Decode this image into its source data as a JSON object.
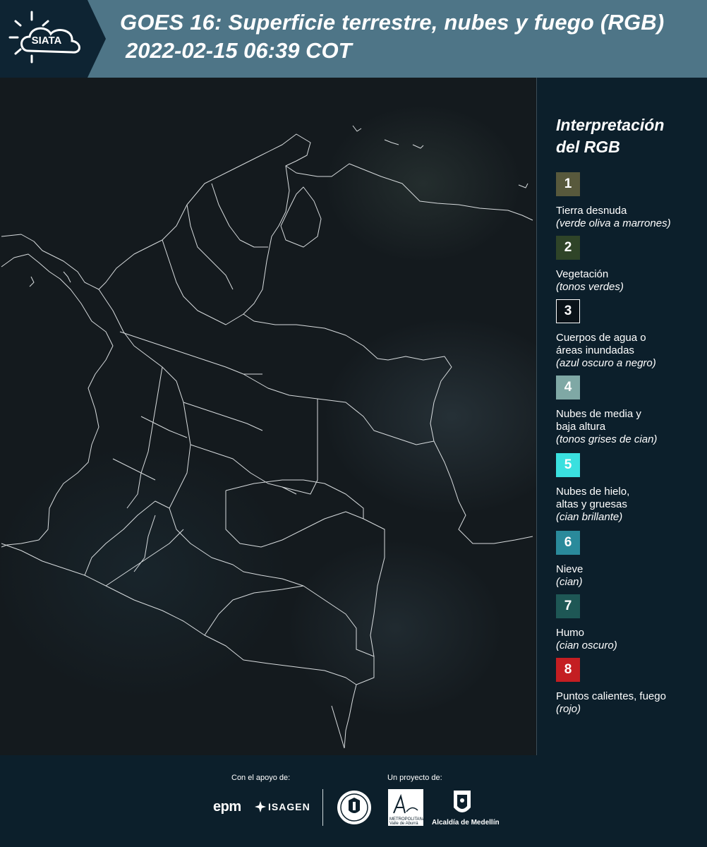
{
  "header": {
    "logo_text": "SIATA",
    "title_line1": "GOES 16: Superficie terrestre, nubes y fuego (RGB)",
    "title_line2": "2022-02-15 06:39 COT"
  },
  "map": {
    "icon": "colombia-satellite-map"
  },
  "legend": {
    "title_line1": "Interpretación",
    "title_line2": "del RGB",
    "items": [
      {
        "number": "1",
        "color": "#58593c",
        "label_lines": [
          "Tierra desnuda"
        ],
        "desc_lines": [
          "(verde oliva a marrones)"
        ]
      },
      {
        "number": "2",
        "color": "#2f4428",
        "label_lines": [
          "Vegetación"
        ],
        "desc_lines": [
          "(tonos verdes)"
        ]
      },
      {
        "number": "3",
        "color": "#0a1218",
        "label_lines": [
          "Cuerpos de agua o",
          "áreas inundadas"
        ],
        "desc_lines": [
          "(azul oscuro a negro)"
        ]
      },
      {
        "number": "4",
        "color": "#7fa8a5",
        "label_lines": [
          "Nubes de media y",
          "baja altura"
        ],
        "desc_lines": [
          "(tonos grises de cian)"
        ]
      },
      {
        "number": "5",
        "color": "#3ae0df",
        "label_lines": [
          "Nubes de hielo,",
          "altas y gruesas"
        ],
        "desc_lines": [
          "(cian brillante)"
        ]
      },
      {
        "number": "6",
        "color": "#2a8a9b",
        "label_lines": [
          "Nieve"
        ],
        "desc_lines": [
          "(cian)"
        ]
      },
      {
        "number": "7",
        "color": "#1e5755",
        "label_lines": [
          "Humo"
        ],
        "desc_lines": [
          "(cian oscuro)"
        ]
      },
      {
        "number": "8",
        "color": "#c41e22",
        "label_lines": [
          "Puntos calientes, fuego"
        ],
        "desc_lines": [
          "(rojo)"
        ]
      }
    ]
  },
  "footer": {
    "support_label": "Con el apoyo de:",
    "project_label": "Un proyecto de:",
    "epm": "epm",
    "isagen": "ISAGEN",
    "metro_line1": "METROPOLITANA",
    "metro_line2": "Valle de Aburrá",
    "alcaldia": "Alcaldía de Medellín"
  }
}
